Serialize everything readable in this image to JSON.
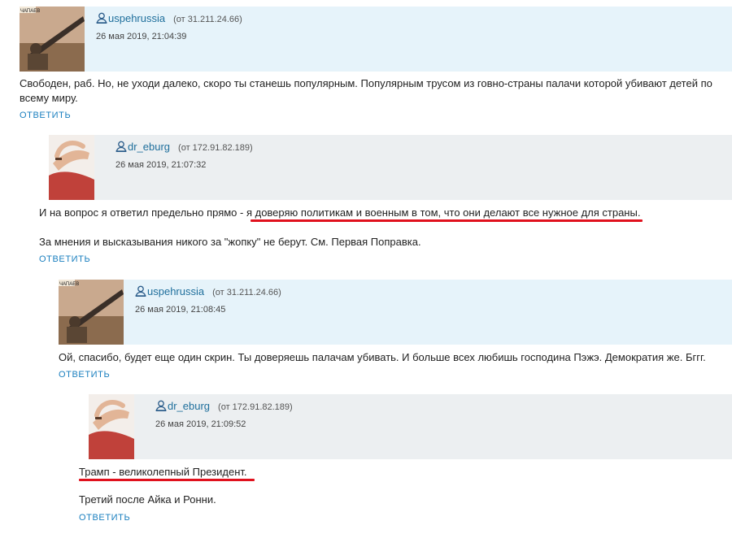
{
  "comments": [
    {
      "author": "uspehrussia",
      "ip": "(от 31.211.24.66)",
      "date": "26 мая 2019, 21:04:39",
      "paragraphs": [
        "Свободен, раб. Но, не уходи далеко, скоро ты станешь популярным. Популярным трусом из говно-страны палачи которой убивают детей по всему миру."
      ],
      "reply_label": "ОТВЕТИТЬ"
    },
    {
      "author": "dr_eburg",
      "ip": "(от 172.91.82.189)",
      "date": "26 мая 2019, 21:07:32",
      "paragraphs": [
        "И на вопрос я ответил предельно прямо - я доверяю политикам и военным в том, что они делают все нужное для страны.",
        "За мнения и высказывания никого за \"жопку\" не берут. См. Первая Поправка."
      ],
      "reply_label": "ОТВЕТИТЬ"
    },
    {
      "author": "uspehrussia",
      "ip": "(от 31.211.24.66)",
      "date": "26 мая 2019, 21:08:45",
      "paragraphs": [
        "Ой, спасибо, будет еще один скрин. Ты доверяешь палачам убивать. И больше всех любишь господина Пэжэ. Демократия же. Бггг."
      ],
      "reply_label": "ОТВЕТИТЬ"
    },
    {
      "author": "dr_eburg",
      "ip": "(от 172.91.82.189)",
      "date": "26 мая 2019, 21:09:52",
      "paragraphs": [
        "Трамп - великолепный Президент.",
        "Третий после Айка и Ронни."
      ],
      "reply_label": "ОТВЕТИТЬ"
    }
  ],
  "avatar_poster_text": "ЧАПАЕВ",
  "colors": {
    "head_blue": "#e6f3fa",
    "head_gray": "#eceff1",
    "link": "#1a7fbf",
    "author": "#1f6f9c",
    "highlight_underline": "#e0111d"
  }
}
